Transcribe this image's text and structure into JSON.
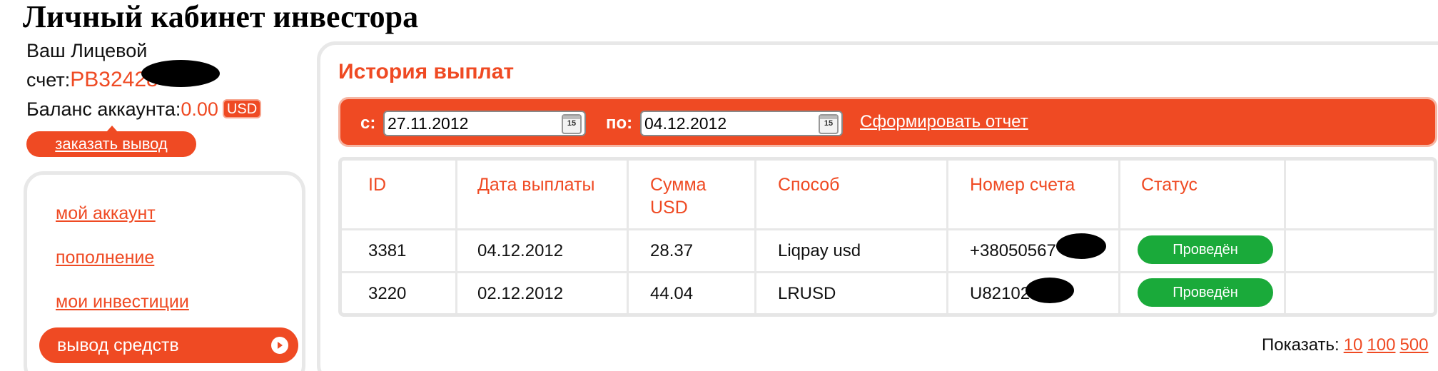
{
  "page": {
    "title": "Личный кабинет инвестора"
  },
  "account": {
    "label_line1": "Ваш Лицевой",
    "label_line2": "счет:",
    "number": "PB32428",
    "balance_label": "Баланс аккаунта:",
    "balance_value": "0.00",
    "currency": "USD",
    "withdraw_button": "заказать вывод"
  },
  "sidebar": {
    "items": [
      {
        "label": "мой аккаунт",
        "active": false
      },
      {
        "label": "пополнение",
        "active": false
      },
      {
        "label": "мои инвестиции",
        "active": false
      },
      {
        "label": "вывод средств",
        "active": true
      }
    ]
  },
  "main": {
    "section_title": "История выплат",
    "filter": {
      "from_label": "с:",
      "from_value": "27.11.2012",
      "to_label": "по:",
      "to_value": "04.12.2012",
      "calendar_icon_text": "15",
      "report_link": "Сформировать отчет"
    },
    "table": {
      "headers": [
        "ID",
        "Дата выплаты",
        "Сумма USD",
        "Способ",
        "Номер счета",
        "Статус"
      ],
      "rows": [
        {
          "id": "3381",
          "date": "04.12.2012",
          "amount": "28.37",
          "method": "Liqpay usd",
          "account": "+38050567",
          "status": "Проведён"
        },
        {
          "id": "3220",
          "date": "02.12.2012",
          "amount": "44.04",
          "method": "LRUSD",
          "account": "U82102",
          "status": "Проведён"
        }
      ]
    },
    "pager": {
      "label": "Показать:",
      "options": [
        "10",
        "100",
        "500"
      ]
    }
  },
  "colors": {
    "accent": "#ef4a23",
    "status_green": "#1aaa3a",
    "border_gray": "#e8e8e8"
  }
}
